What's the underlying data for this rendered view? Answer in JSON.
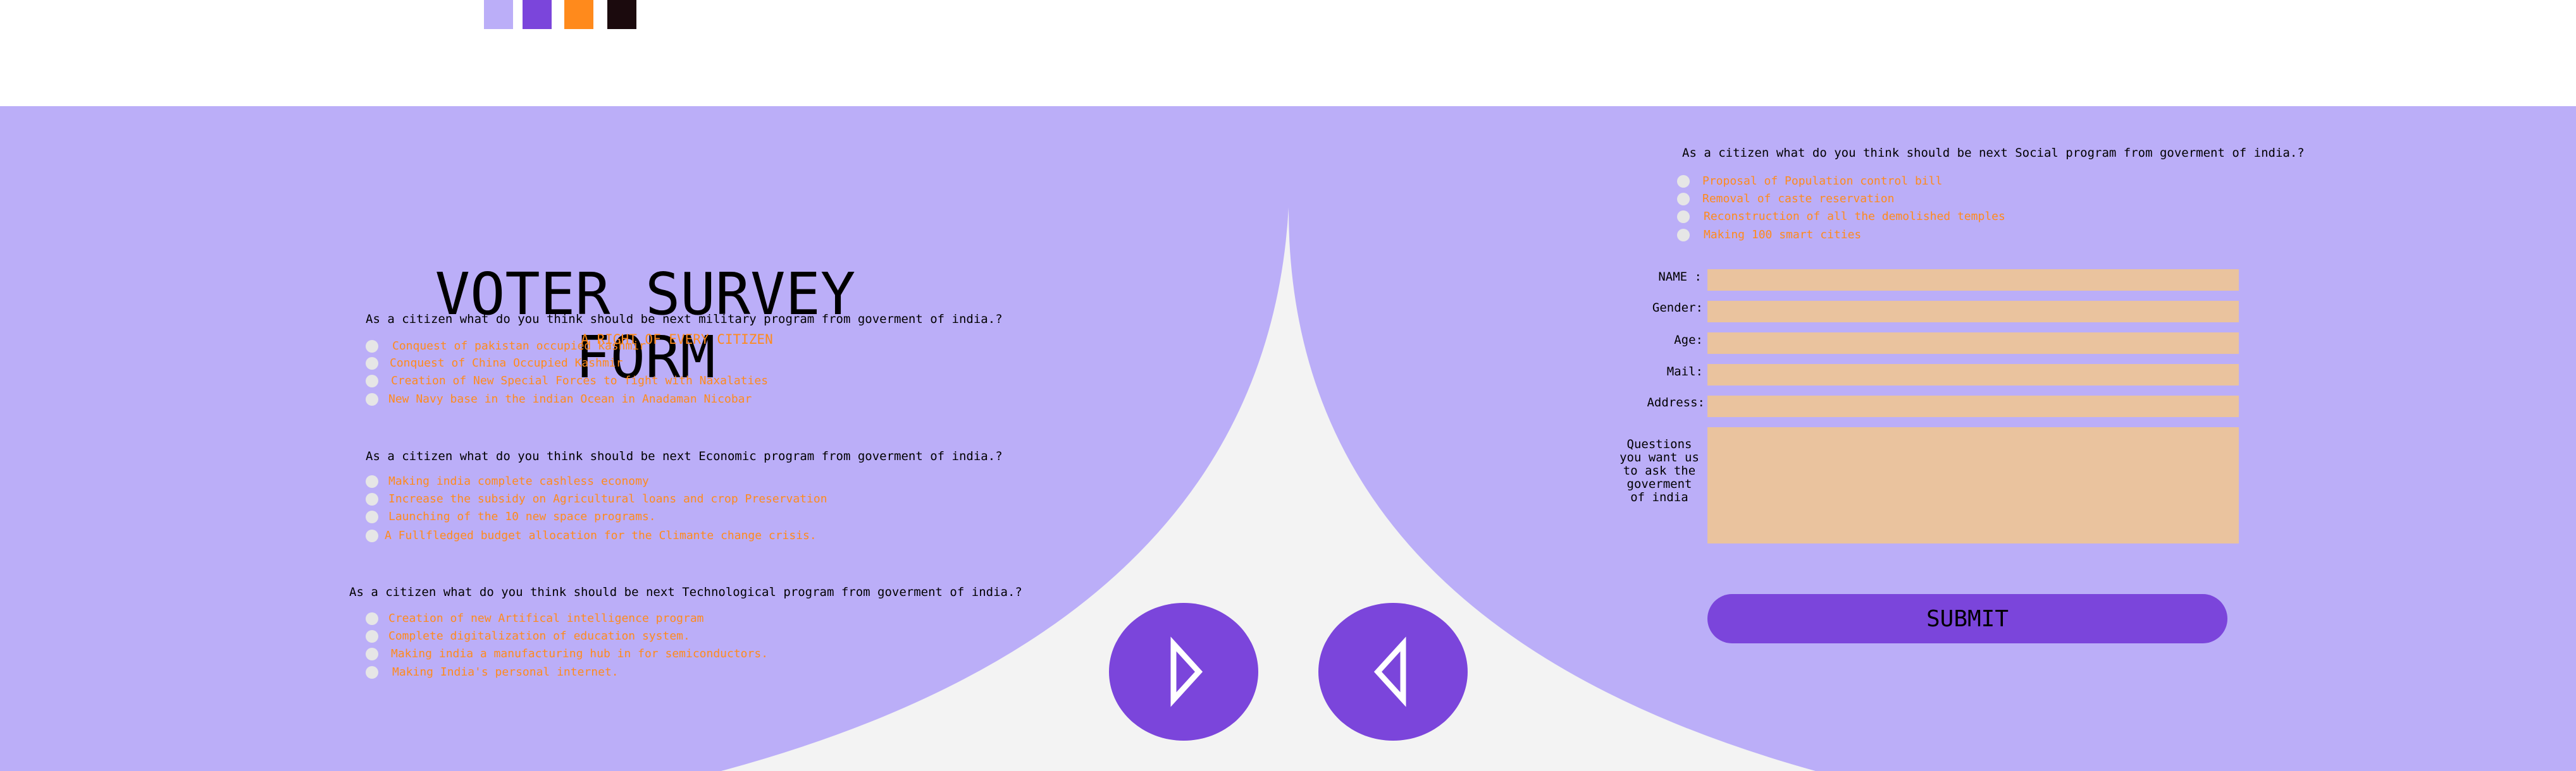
{
  "palette": {
    "swatches": [
      "#bbaef8",
      "#7b45db",
      "#ff8a1c",
      "#1b0a0d"
    ],
    "band": "#bbaef8",
    "curve": "#f3f3f3",
    "accent": "#7b45db",
    "option_text": "#ff8a1c",
    "field": "#eac39e"
  },
  "header": {
    "title": "VOTER SURVEY FORM",
    "subtitle": "A RIGHT OF EVERY CITIZEN"
  },
  "questions": [
    {
      "text": "As a citizen what do you think should be next military program from goverment of india.?",
      "options": [
        "Conquest of pakistan occupied kashmir",
        "Conquest of China Occupied Kashmir",
        "Creation of New Special Forces to fight with Naxalaties",
        "New Navy base in the indian Ocean in Anadaman Nicobar"
      ]
    },
    {
      "text": "As a citizen what do you think should be next Economic program from goverment of india.?",
      "options": [
        "Making india complete cashless economy",
        "Increase the subsidy on Agricultural loans and crop Preservation",
        "Launching of the 10 new space programs.",
        "A Fullfledged budget allocation for the Climante change crisis."
      ]
    },
    {
      "text": "As a citizen what do you think should be next Technological program from goverment of india.?",
      "options": [
        "Creation of new Artifical intelligence program",
        "Complete digitalization of education system.",
        "Making india a manufacturing hub in for semiconductors.",
        "Making India's personal internet."
      ]
    },
    {
      "text": "As a citizen what do you think should be next Social program from goverment of india.?",
      "options": [
        "Proposal of Population control bill",
        "Removal of caste reservation",
        "Reconstruction of all the demolished temples",
        "Making 100 smart cities"
      ]
    }
  ],
  "navigation": {
    "next_icon": "play-right-triangle-icon",
    "previous_icon": "play-left-triangle-icon"
  },
  "form": {
    "fields": [
      {
        "label": "NAME :",
        "value": ""
      },
      {
        "label": "Gender:",
        "value": ""
      },
      {
        "label": "Age:",
        "value": ""
      },
      {
        "label": "Mail:",
        "value": ""
      },
      {
        "label": "Address:",
        "value": ""
      }
    ],
    "questions_label": "Questions you want us to ask the goverment of india",
    "questions_value": "",
    "submit_label": "SUBMIT"
  }
}
